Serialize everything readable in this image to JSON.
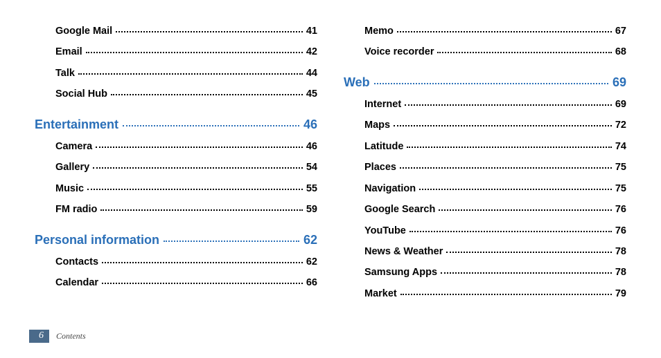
{
  "columns": [
    {
      "groups": [
        {
          "heading": null,
          "items": [
            {
              "label": "Google Mail",
              "page": "41"
            },
            {
              "label": "Email",
              "page": "42"
            },
            {
              "label": "Talk",
              "page": "44"
            },
            {
              "label": "Social Hub",
              "page": "45"
            }
          ]
        },
        {
          "heading": {
            "label": "Entertainment",
            "page": "46"
          },
          "items": [
            {
              "label": "Camera",
              "page": "46"
            },
            {
              "label": "Gallery",
              "page": "54"
            },
            {
              "label": "Music",
              "page": "55"
            },
            {
              "label": "FM radio",
              "page": "59"
            }
          ]
        },
        {
          "heading": {
            "label": "Personal information",
            "page": "62"
          },
          "items": [
            {
              "label": "Contacts",
              "page": "62"
            },
            {
              "label": "Calendar",
              "page": "66"
            }
          ]
        }
      ]
    },
    {
      "groups": [
        {
          "heading": null,
          "items": [
            {
              "label": "Memo",
              "page": "67"
            },
            {
              "label": "Voice recorder",
              "page": "68"
            }
          ]
        },
        {
          "heading": {
            "label": "Web",
            "page": "69"
          },
          "items": [
            {
              "label": "Internet",
              "page": "69"
            },
            {
              "label": "Maps",
              "page": "72"
            },
            {
              "label": "Latitude",
              "page": "74"
            },
            {
              "label": "Places",
              "page": "75"
            },
            {
              "label": "Navigation",
              "page": "75"
            },
            {
              "label": "Google Search",
              "page": "76"
            },
            {
              "label": "YouTube",
              "page": "76"
            },
            {
              "label": "News & Weather",
              "page": "78"
            },
            {
              "label": "Samsung Apps",
              "page": "78"
            },
            {
              "label": "Market",
              "page": "79"
            }
          ]
        }
      ]
    }
  ],
  "footer": {
    "page_number": "6",
    "label": "Contents"
  }
}
